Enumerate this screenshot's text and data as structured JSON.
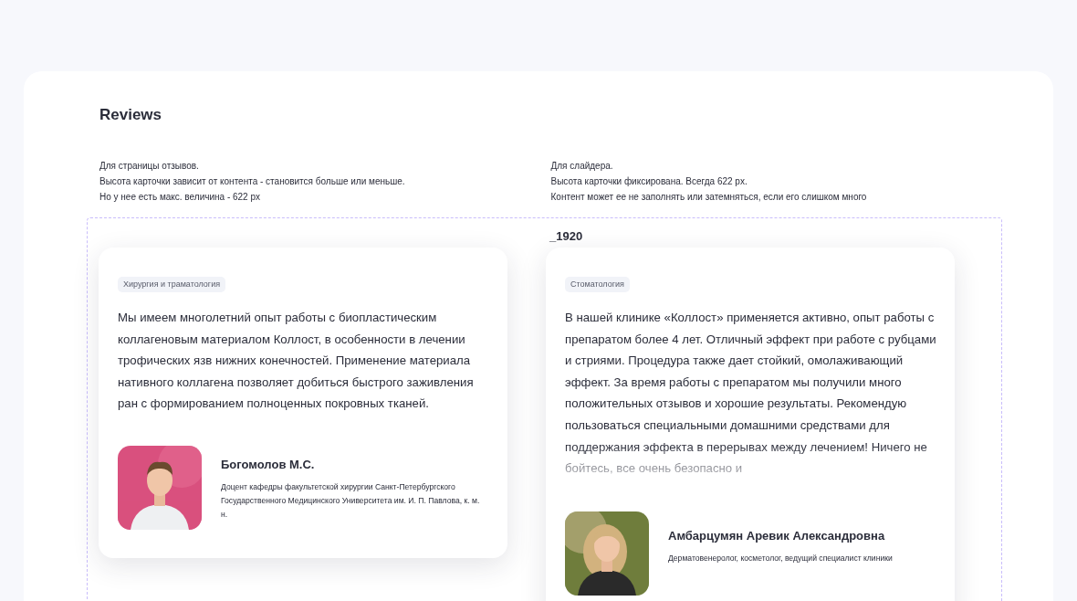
{
  "title": "Reviews",
  "notes": [
    {
      "lines": [
        "Для страницы отзывов.",
        "Высота карточки зависит от контента - становится больше или меньше.",
        "Но у нее есть макс. величина - 622 px"
      ]
    },
    {
      "lines": [
        "Для слайдера.",
        "Высота карточки фиксирована. Всегда 622 px.",
        "Контент может ее не заполнять или затемняться, если его слишком много"
      ]
    }
  ],
  "frame_label": "_1920",
  "reviews": [
    {
      "tag": "Хирургия и траматология",
      "text": "Мы имеем многолетний опыт работы с биопластическим коллагеновым материалом Коллост, в особенности в лечении трофических язв нижних конечностей. Применение материала нативного коллагена позволяет добиться быстрого заживления ран с формированием полноценных покровных тканей.",
      "faded": false,
      "name": "Богомолов М.С.",
      "role": "Доцент кафедры факультетской хирургии Санкт-Петербургского Государственного Медицинского Университета  им. И. П. Павлова, к. м. н."
    },
    {
      "tag": "Стоматология",
      "text": "В нашей клинике «Коллост» применяется активно, опыт работы с препаратом более 4 лет. Отличный эффект при работе с рубцами и стриями. Процедура также дает стойкий, омолаживающий эффект. За время работы с препаратом мы получили много положительных отзывов и хорошие результаты. Рекомендую пользоваться специальными домашними средствами для поддержания эффекта в перерывах между лечением! Ничего не бойтесь, все очень безопасно и",
      "faded": true,
      "name": "Амбарцумян Аревик Александровна",
      "role": "Дерматовенеролог, косметолог, ведущий специалист клиники"
    }
  ]
}
